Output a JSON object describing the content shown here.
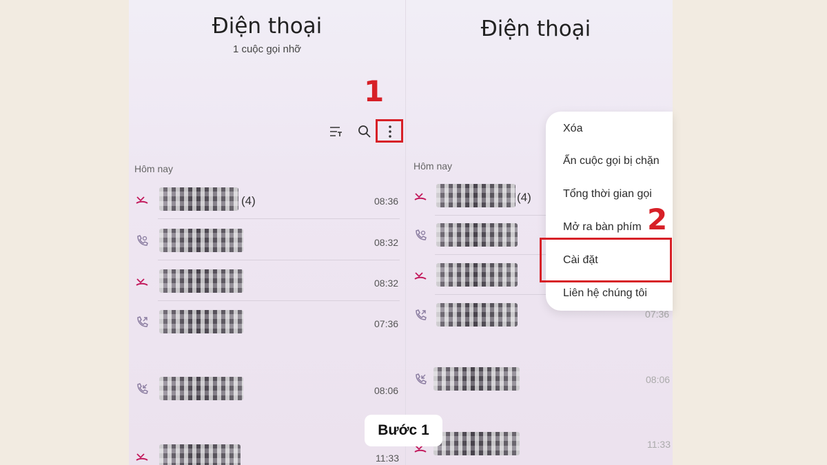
{
  "left_screen": {
    "title": "Điện thoại",
    "subtitle": "1 cuộc gọi nhỡ",
    "section_label": "Hôm nay",
    "calls": [
      {
        "icon": "missed-call-icon",
        "count": "(4)",
        "time": "08:36"
      },
      {
        "icon": "voicemail-call-icon",
        "count": "",
        "time": "08:32"
      },
      {
        "icon": "missed-call-icon",
        "count": "",
        "time": "08:32"
      },
      {
        "icon": "outgoing-call-icon",
        "count": "",
        "time": "07:36"
      },
      {
        "icon": "incoming-call-icon",
        "count": "",
        "time": "08:06"
      },
      {
        "icon": "missed-call-icon",
        "count": "",
        "time": "11:33"
      }
    ]
  },
  "right_screen": {
    "title": "Điện thoại",
    "section_label": "Hôm nay",
    "calls": [
      {
        "icon": "missed-call-icon",
        "count": "(4)",
        "time": ""
      },
      {
        "icon": "voicemail-call-icon",
        "count": "",
        "time": ""
      },
      {
        "icon": "missed-call-icon",
        "count": "",
        "time": ""
      },
      {
        "icon": "outgoing-call-icon",
        "count": "",
        "time": "07:36"
      },
      {
        "icon": "incoming-call-icon",
        "count": "",
        "time": "08:06"
      },
      {
        "icon": "missed-call-icon",
        "count": "",
        "time": "11:33"
      }
    ]
  },
  "menu": {
    "items": [
      "Xóa",
      "Ẩn cuộc gọi bị chặn",
      "Tổng thời gian gọi",
      "Mở ra bàn phím",
      "Cài đặt",
      "Liên hệ chúng tôi"
    ]
  },
  "annotations": {
    "step1_number": "1",
    "step2_number": "2",
    "caption": "Bước 1",
    "highlight_color": "#d72027"
  }
}
